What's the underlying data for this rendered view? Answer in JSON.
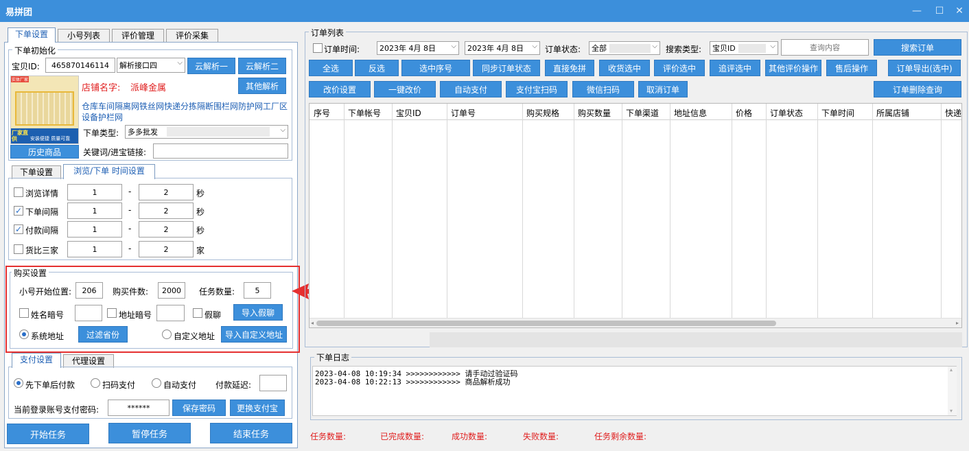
{
  "app": {
    "title": "易拼团",
    "controls": [
      "—",
      "☐",
      "✕"
    ]
  },
  "left_tabs": [
    "下单设置",
    "小号列表",
    "评价管理",
    "评价采集"
  ],
  "init": {
    "title": "下单初始化",
    "item_id_label": "宝贝ID:",
    "item_id_value": "465870146114",
    "api_select": "解析接口四",
    "cloud1": "云解析一",
    "cloud2": "云解析二",
    "other": "其他解析",
    "shop_label": "店铺名字:",
    "shop_name": "派峰金属",
    "product_title": "仓库车间隔离网铁丝网快递分拣隔断围栏网防护网工厂区设备护栏网",
    "order_type_label": "下单类型:",
    "order_type_value": "多多批发",
    "history_btn": "历史商品",
    "keyword_label": "关键词/进宝链接:",
    "keyword_value": "",
    "thumb_badge1": "厂家直供",
    "thumb_badge2": "安装便捷 质量可靠",
    "thumb_tag": "实体厂家"
  },
  "sub_tabs": [
    "下单设置",
    "浏览/下单 时间设置"
  ],
  "timing": [
    {
      "label": "浏览详情",
      "checked": false,
      "min": "1",
      "max": "2",
      "unit": "秒"
    },
    {
      "label": "下单间隔",
      "checked": true,
      "min": "1",
      "max": "2",
      "unit": "秒"
    },
    {
      "label": "付款间隔",
      "checked": true,
      "min": "1",
      "max": "2",
      "unit": "秒"
    },
    {
      "label": "货比三家",
      "checked": false,
      "min": "1",
      "max": "2",
      "unit": "家"
    }
  ],
  "dash": "-",
  "buy": {
    "title": "购买设置",
    "start_label": "小号开始位置:",
    "start_value": "206",
    "qty_label": "购买件数:",
    "qty_value": "2000",
    "task_label": "任务数量:",
    "task_value": "5",
    "name_code": "姓名暗号",
    "addr_code": "地址暗号",
    "fake_chat": "假聊",
    "import_fake": "导入假聊",
    "system_addr": "系统地址",
    "filter_prov": "过滤省份",
    "custom_addr": "自定义地址",
    "import_custom": "导入自定义地址"
  },
  "pay_tabs": [
    "支付设置",
    "代理设置"
  ],
  "pay": {
    "opt1": "先下单后付款",
    "opt2": "扫码支付",
    "opt3": "自动支付",
    "delay_label": "付款延迟:",
    "delay_value": "",
    "pwd_label": "当前登录账号支付密码:",
    "pwd_value": "******",
    "save_pwd": "保存密码",
    "change_alipay": "更换支付宝"
  },
  "actions": {
    "start": "开始任务",
    "pause": "暂停任务",
    "end": "结束任务"
  },
  "orders": {
    "title": "订单列表",
    "time_label": "订单时间:",
    "date1": "2023年 4月 8日",
    "date2": "2023年 4月 8日",
    "status_label": "订单状态:",
    "status_value": "全部",
    "search_type_label": "搜索类型:",
    "search_type_value": "宝贝ID",
    "query_placeholder": "查询内容",
    "search_btn": "搜索订单",
    "row1": [
      "全选",
      "反选",
      "选中序号",
      "同步订单状态",
      "直接免拼",
      "收货选中",
      "评价选中",
      "追评选中",
      "其他评价操作",
      "售后操作",
      "订单导出(选中)"
    ],
    "row2": [
      "改价设置",
      "一键改价",
      "自动支付",
      "支付宝扫码",
      "微信扫码",
      "取消订单"
    ],
    "delete_query": "订单删除查询",
    "columns": [
      "序号",
      "下单帐号",
      "宝贝ID",
      "订单号",
      "购买规格",
      "购买数量",
      "下单渠道",
      "地址信息",
      "价格",
      "订单状态",
      "下单时间",
      "所属店铺",
      "快递"
    ]
  },
  "log": {
    "title": "下单日志",
    "lines": [
      "2023-04-08 10:19:34 >>>>>>>>>>>> 请手动过验证码",
      "2023-04-08 10:22:13 >>>>>>>>>>>> 商品解析成功"
    ]
  },
  "stats": [
    "任务数量:",
    "已完成数量:",
    "成功数量:",
    "失败数量:",
    "任务剩余数量:"
  ],
  "colors": {
    "accent": "#3c8fdb",
    "highlight": "#e53030"
  }
}
